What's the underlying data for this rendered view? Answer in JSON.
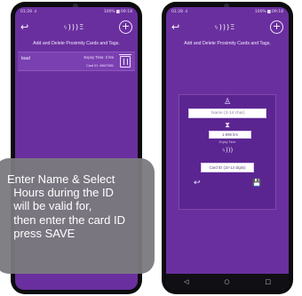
{
  "left_phone": {
    "status": {
      "left": "01:28 .ıl",
      "right": "100% ▆ 09:18"
    },
    "back_icon": "↩",
    "logo": "ᛃ)))Ξ",
    "add_icon": "+",
    "subtitle": "Add and Delete Proximity Cards and Tags.",
    "tag": {
      "name": "toad",
      "expiry": "Expiry Time: 2 hrs",
      "card_id": "Card ID: 456/7651"
    }
  },
  "right_phone": {
    "status": {
      "left": "01:28 .ıl",
      "right": "100% ▆ 09:18"
    },
    "back_icon": "↩",
    "logo": "ᛃ)))Ξ",
    "add_icon": "+",
    "subtitle": "Add and Delete Proximity Cards and Tags.",
    "form": {
      "user_icon": "♙",
      "name_placeholder": "Name (3-14 char)",
      "hourglass_icon": "⧗",
      "expiry_value": "1-999 hrs",
      "expiry_caption": "Expiry Time",
      "nfc_icon": "ᛃ)))",
      "card_placeholder": "Card ID (10-13 digits)",
      "cancel_icon": "↩",
      "save_icon": "💾"
    },
    "nav": {
      "back": "◁",
      "home": "○",
      "recent": "□"
    }
  },
  "tooltip": {
    "lines": [
      "Enter Name & Select",
      "  Hours during the ID",
      "  will be valid for,",
      "  then enter the card ID",
      "  press SAVE"
    ]
  }
}
